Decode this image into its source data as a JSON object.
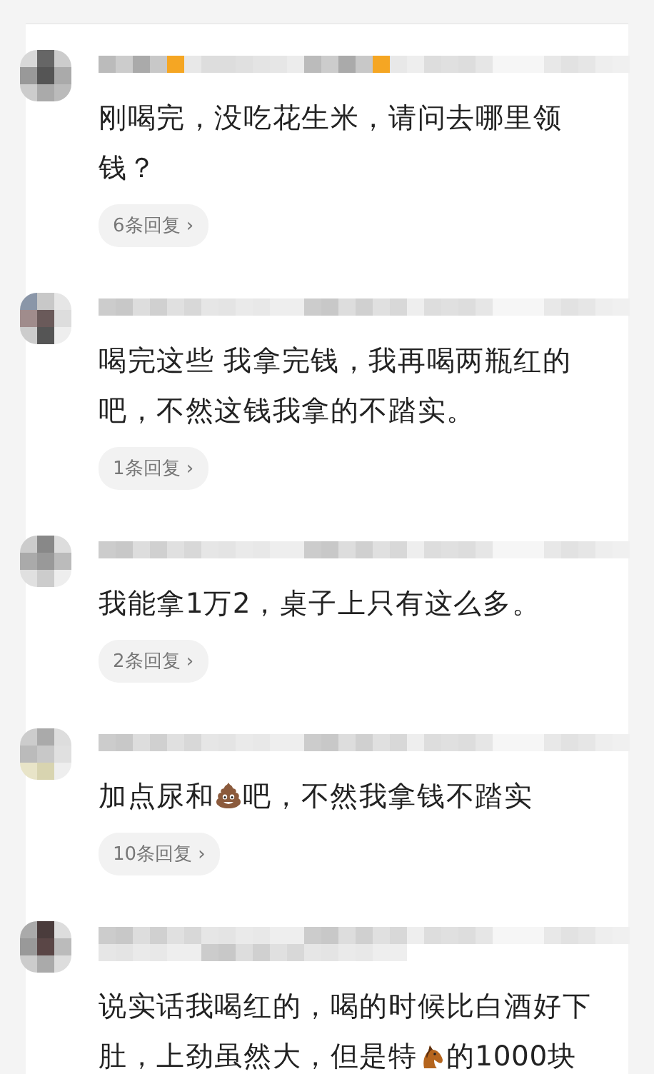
{
  "comments": [
    {
      "segments": [
        {
          "kind": "text",
          "text": "刚喝完，没吃花生米，请问去哪里领钱？"
        }
      ],
      "replies": "6条回复",
      "chevron": "›"
    },
    {
      "segments": [
        {
          "kind": "text",
          "text": "喝完这些  我拿完钱，我再喝两瓶红的吧，不然这钱我拿的不踏实。"
        }
      ],
      "replies": "1条回复",
      "chevron": "›"
    },
    {
      "segments": [
        {
          "kind": "text",
          "text": "我能拿1万2，桌子上只有这么多。"
        }
      ],
      "replies": "2条回复",
      "chevron": "›"
    },
    {
      "segments": [
        {
          "kind": "text",
          "text": "加点尿和"
        },
        {
          "kind": "pile"
        },
        {
          "kind": "text",
          "text": "吧，不然我拿钱不踏实"
        }
      ],
      "replies": "10条回复",
      "chevron": "›"
    },
    {
      "segments": [
        {
          "kind": "text",
          "text": "说实话我喝红的，喝的时候比白酒好下肚，上劲虽然大，但是特"
        },
        {
          "kind": "horse"
        },
        {
          "kind": "text",
          "text": "的1000块"
        }
      ]
    }
  ]
}
